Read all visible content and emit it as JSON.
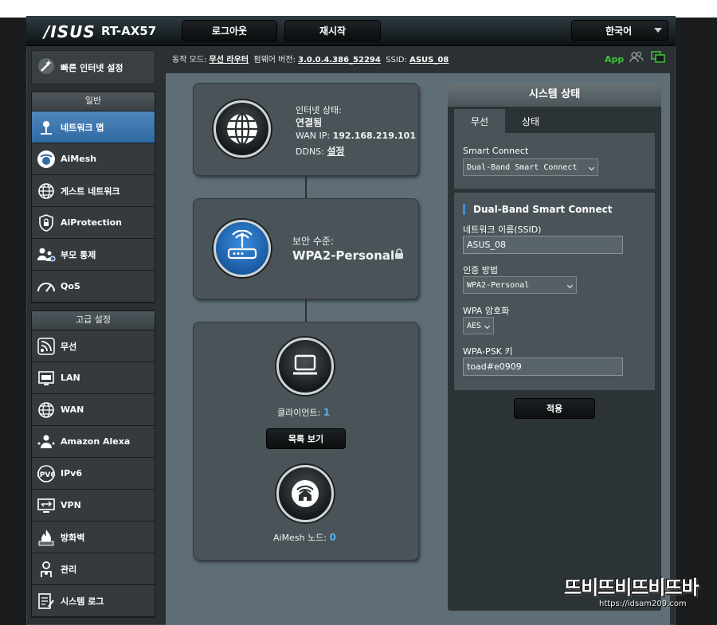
{
  "header": {
    "logo": "/ISUS",
    "model": "RT-AX57",
    "logout_label": "로그아웃",
    "reboot_label": "재시작",
    "language": "한국어"
  },
  "status_line": {
    "mode_label": "동작 모드:",
    "mode_value": "무선 라우터",
    "firmware_label": "펌웨어 버전:",
    "firmware_value": "3.0.0.4.386_52294",
    "ssid_label": "SSID:",
    "ssid_value": "ASUS_08",
    "app_label": "App"
  },
  "sidebar": {
    "qis_label": "빠른 인터넷 설정",
    "general_header": "일반",
    "general_items": [
      {
        "label": "네트워크 맵",
        "icon": "network-map-icon",
        "active": true
      },
      {
        "label": "AiMesh",
        "icon": "aimesh-icon"
      },
      {
        "label": "게스트 네트워크",
        "icon": "globe-icon"
      },
      {
        "label": "AiProtection",
        "icon": "lock-shield-icon"
      },
      {
        "label": "부모 통제",
        "icon": "parental-control-icon"
      },
      {
        "label": "QoS",
        "icon": "speedometer-icon"
      }
    ],
    "advanced_header": "고급 설정",
    "advanced_items": [
      {
        "label": "무선",
        "icon": "wireless-icon"
      },
      {
        "label": "LAN",
        "icon": "lan-icon"
      },
      {
        "label": "WAN",
        "icon": "globe-icon"
      },
      {
        "label": "Amazon Alexa",
        "icon": "alexa-icon"
      },
      {
        "label": "IPv6",
        "icon": "ipv6-icon"
      },
      {
        "label": "VPN",
        "icon": "vpn-icon"
      },
      {
        "label": "방화벽",
        "icon": "firewall-icon"
      },
      {
        "label": "관리",
        "icon": "admin-icon"
      },
      {
        "label": "시스템 로그",
        "icon": "system-log-icon"
      }
    ]
  },
  "network_map": {
    "internet_status_label": "인터넷 상태:",
    "internet_status_value": "연결됨",
    "wan_ip_label": "WAN IP:",
    "wan_ip_value": "192.168.219.101",
    "ddns_label": "DDNS:",
    "ddns_value": "설정",
    "security_level_label": "보안 수준:",
    "security_level_value": "WPA2-Personal",
    "clients_label": "클라이언트:",
    "clients_count": "1",
    "view_list_button": "목록 보기",
    "aimesh_nodes_label": "AiMesh 노드:",
    "aimesh_nodes_count": "0"
  },
  "system_status": {
    "title": "시스템 상태",
    "tabs": [
      "무선",
      "상태"
    ],
    "smart_connect_label": "Smart Connect",
    "smart_connect_value": "Dual-Band Smart Connect",
    "section_title": "Dual-Band Smart Connect",
    "ssid_label": "네트워크 이름(SSID)",
    "ssid_value": "ASUS_08",
    "auth_label": "인증 방법",
    "auth_value": "WPA2-Personal",
    "encryption_label": "WPA 암호화",
    "encryption_value": "AES",
    "psk_label": "WPA-PSK 키",
    "psk_value": "toad#e0909",
    "apply_button": "적용"
  },
  "watermark": {
    "brand": "뜨비뜨비뜨비뜨바",
    "url": "https://idsam209.com"
  },
  "colors": {
    "accent_blue": "#3d8cd6",
    "active_item": "#3a72ab",
    "link_green": "#3cc43a",
    "count_blue": "#5aaee8"
  }
}
